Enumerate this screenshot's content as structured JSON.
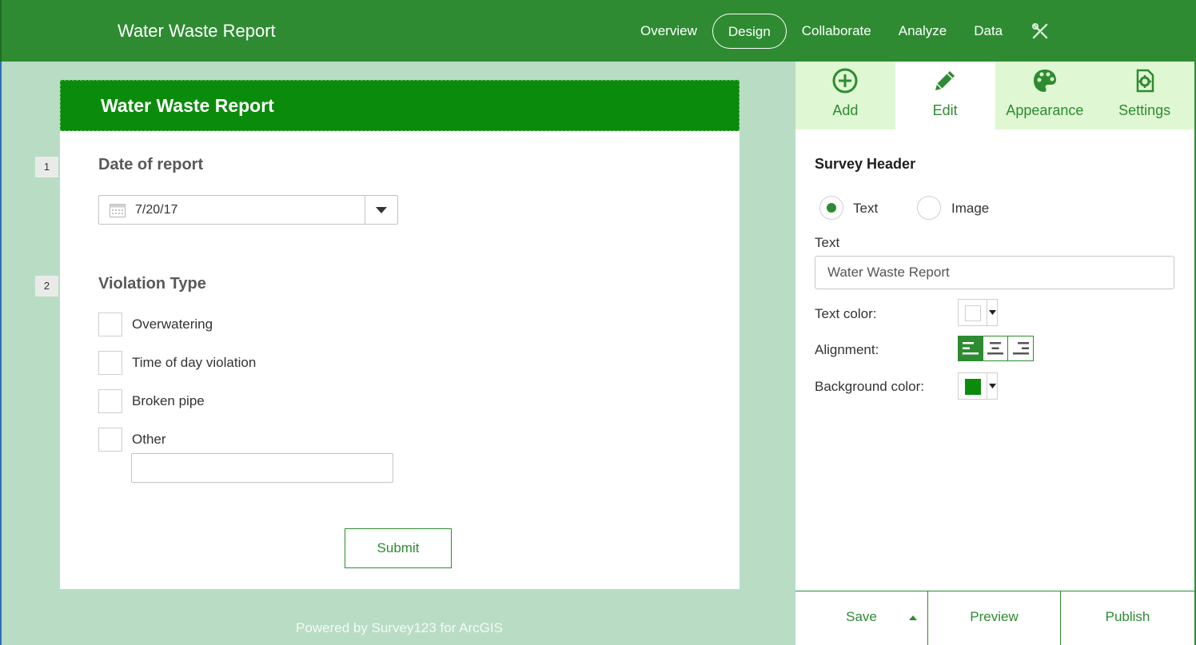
{
  "app": {
    "title": "Water Waste Report"
  },
  "nav": {
    "items": [
      "Overview",
      "Design",
      "Collaborate",
      "Analyze",
      "Data"
    ],
    "active": "Design",
    "tools_icon": "tools-icon"
  },
  "form": {
    "header_title": "Water Waste Report",
    "questions": [
      {
        "number": "1",
        "label": "Date of report",
        "value": "7/20/17"
      },
      {
        "number": "2",
        "label": "Violation Type",
        "options": [
          "Overwatering",
          "Time of day violation",
          "Broken pipe",
          "Other"
        ]
      }
    ],
    "submit_label": "Submit",
    "footer": "Powered by Survey123 for ArcGIS"
  },
  "panel": {
    "tabs": [
      {
        "label": "Add",
        "icon": "plus-circle-icon"
      },
      {
        "label": "Edit",
        "icon": "pencil-icon"
      },
      {
        "label": "Appearance",
        "icon": "palette-icon"
      },
      {
        "label": "Settings",
        "icon": "settings-doc-icon"
      }
    ],
    "active_tab": "Edit",
    "section_title": "Survey Header",
    "radio_text": "Text",
    "radio_image": "Image",
    "radio_selected": "Text",
    "text_label": "Text",
    "text_value": "Water Waste Report",
    "text_color_label": "Text color:",
    "text_color": "#ffffff",
    "alignment_label": "Alignment:",
    "alignment": "left",
    "bg_color_label": "Background color:",
    "bg_color": "#0b8b0b",
    "save_label": "Save",
    "preview_label": "Preview",
    "publish_label": "Publish"
  },
  "colors": {
    "brand": "#2e8b32",
    "header_bg": "#0b8b0b",
    "canvas_bg": "#b9dcc5",
    "tab_bg": "#dff7d2"
  }
}
